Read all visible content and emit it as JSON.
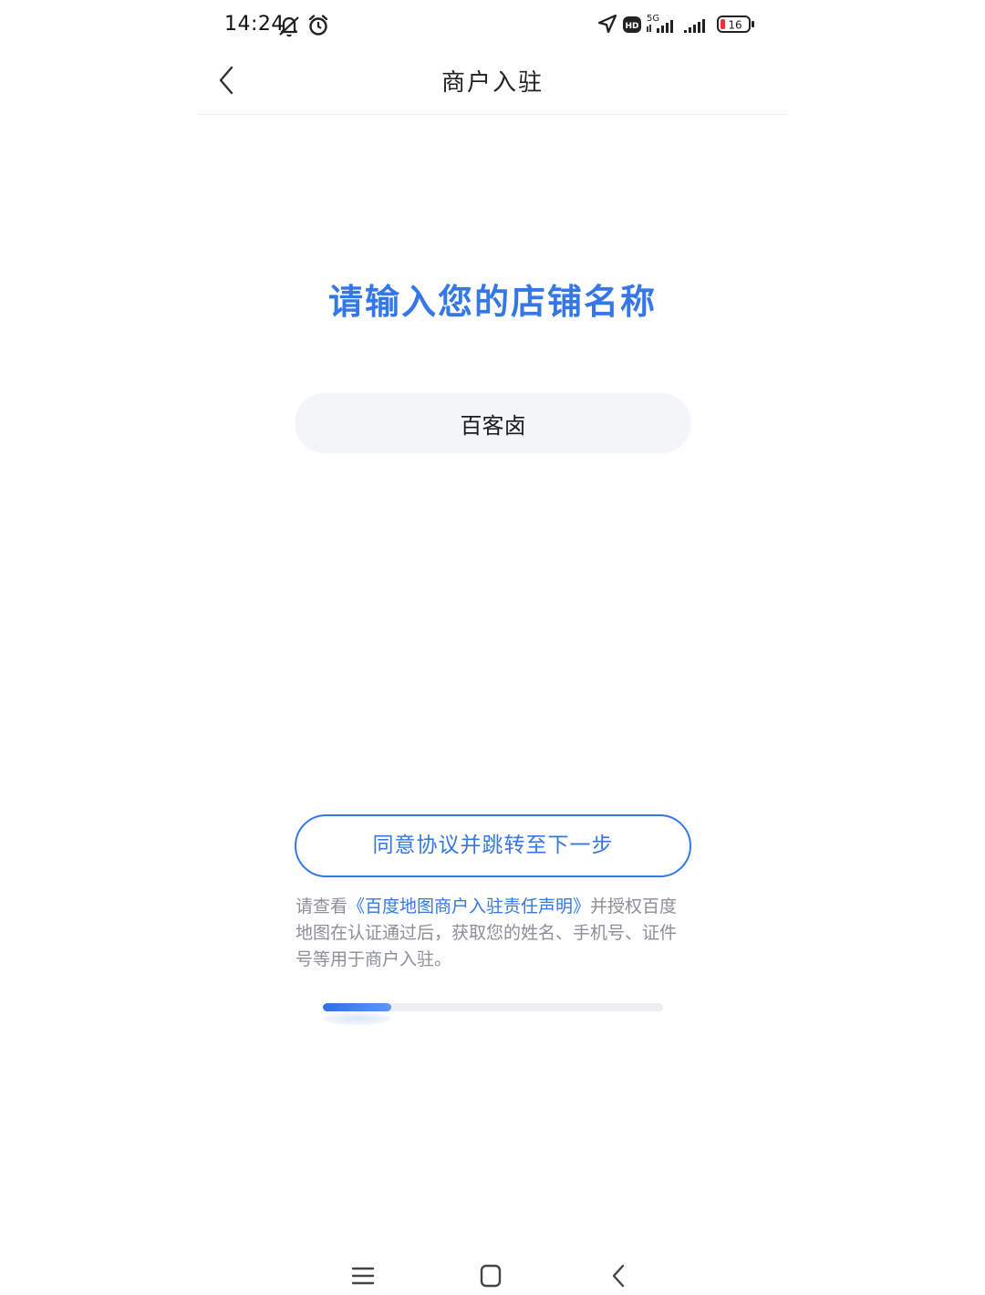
{
  "status_bar": {
    "time": "14:24",
    "network": "5G",
    "hd_badge": "HD",
    "battery": "16",
    "icons": [
      "mute-icon",
      "alarm-icon",
      "location-icon",
      "hd-icon",
      "signal-5g-icon",
      "signal-icon",
      "battery-icon"
    ],
    "battery_low_color": "#e53935"
  },
  "nav": {
    "title": "商户入驻"
  },
  "main": {
    "prompt_title": "请输入您的店铺名称",
    "store_name_value": "百客卤",
    "agree_button_label": "同意协议并跳转至下一步",
    "agreement": {
      "prefix": "请查看",
      "link": "《百度地图商户入驻责任声明》",
      "suffix": "并授权百度地图在认证通过后，获取您的姓名、手机号、证件号等用于商户入驻。"
    },
    "progress": 0.2
  },
  "colors": {
    "accent": "#3577e4",
    "input_bg": "#f3f5f8",
    "muted_text": "#8a8f99"
  },
  "system_nav": {
    "icons": [
      "menu-icon",
      "home-icon",
      "back-icon"
    ]
  }
}
